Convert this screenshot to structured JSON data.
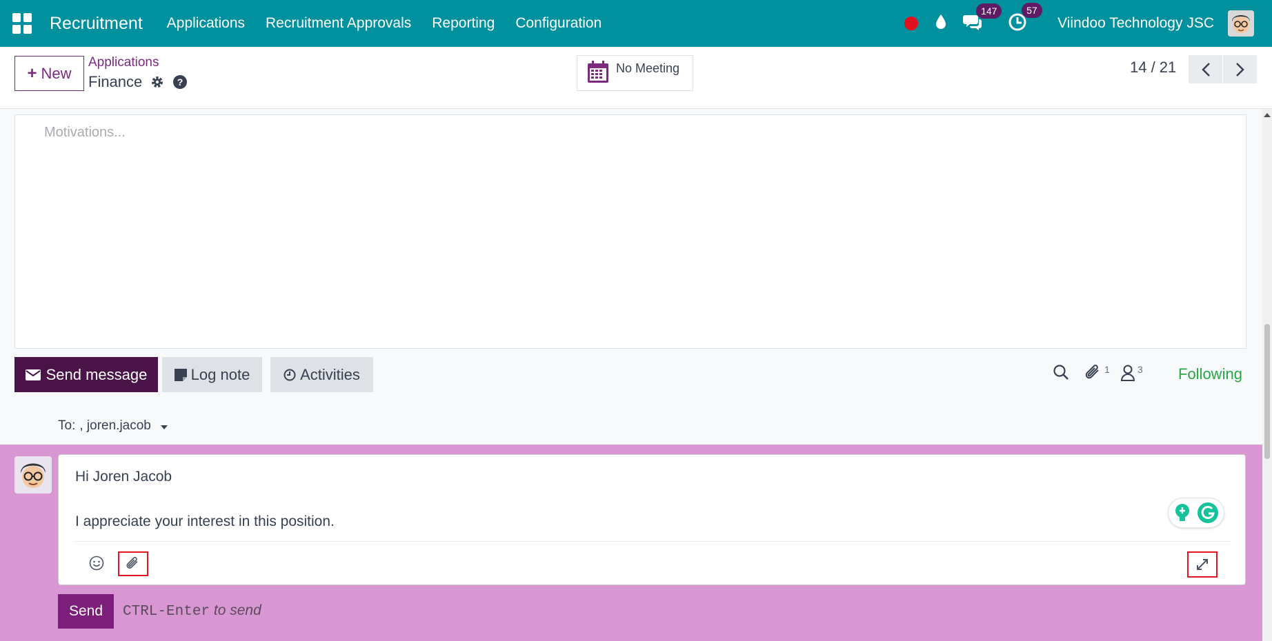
{
  "topbar": {
    "app_name": "Recruitment",
    "menu": [
      "Applications",
      "Recruitment Approvals",
      "Reporting",
      "Configuration"
    ],
    "messages_count": "147",
    "activities_count": "57",
    "company": "Viindoo Technology JSC"
  },
  "control": {
    "new_label": "New",
    "breadcrumb_parent": "Applications",
    "breadcrumb_current": "Finance",
    "meeting_label": "No Meeting",
    "pager": "14 / 21"
  },
  "form": {
    "motivations_placeholder": "Motivations..."
  },
  "chatter": {
    "send_message_label": "Send message",
    "log_note_label": "Log note",
    "activities_label": "Activities",
    "attachments_count": "1",
    "followers_count": "3",
    "following_label": "Following",
    "to_label": "To:",
    "to_value": ", joren.jacob",
    "composer_line1": "Hi Joren Jacob",
    "composer_line2": "I appreciate your interest in this position.",
    "send_label": "Send",
    "hint_key": "CTRL-Enter",
    "hint_text": "to send"
  },
  "colors": {
    "topbar": "#00909e",
    "primary": "#7c2a7f",
    "send_message_bg": "#4b1449",
    "composer_bg": "#d896d3",
    "following": "#28a745",
    "highlight_box": "#e3161e"
  }
}
